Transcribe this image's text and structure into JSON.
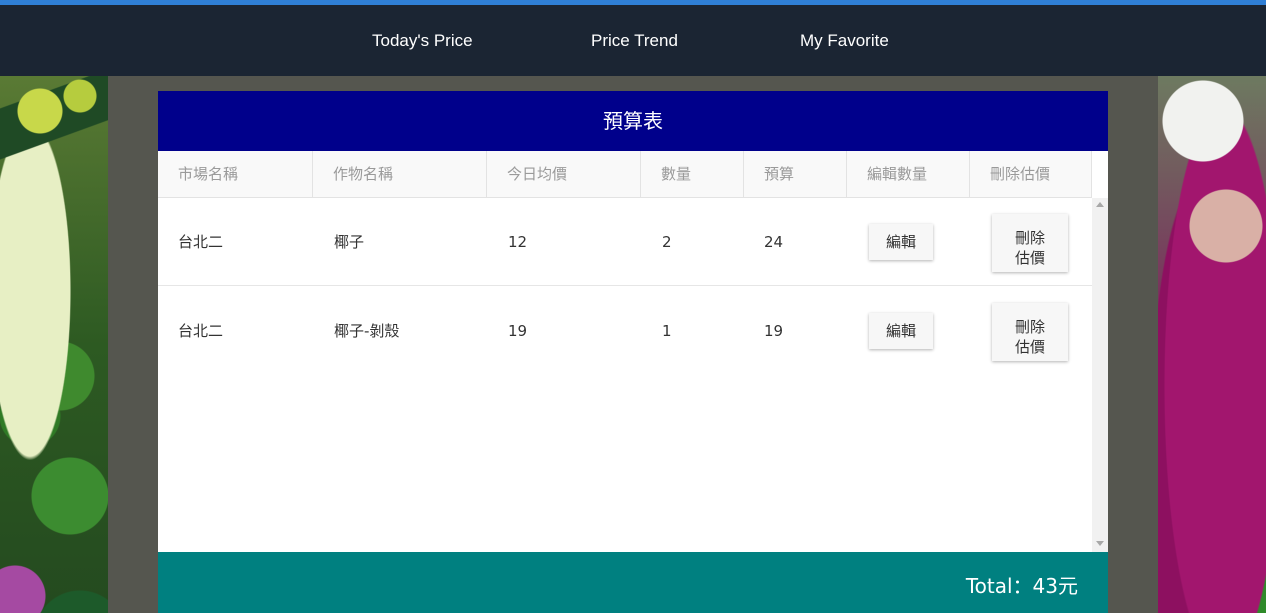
{
  "nav": {
    "items": [
      {
        "label": "Today's Price"
      },
      {
        "label": "Price Trend"
      },
      {
        "label": "My Favorite"
      }
    ]
  },
  "budget": {
    "title": "預算表",
    "columns": [
      "市場名稱",
      "作物名稱",
      "今日均價",
      "數量",
      "預算",
      "編輯數量",
      "刪除估價"
    ],
    "rows": [
      {
        "market": "台北二",
        "crop": "椰子",
        "avg_price": "12",
        "quantity": "2",
        "budget": "24",
        "edit_label": "編輯",
        "delete_label": "刪除\n估價"
      },
      {
        "market": "台北二",
        "crop": "椰子-剝殼",
        "avg_price": "19",
        "quantity": "1",
        "budget": "19",
        "edit_label": "編輯",
        "delete_label": "刪除\n估價"
      }
    ],
    "total": "Total：43元"
  },
  "colors": {
    "topbar": "#1b2533",
    "accent_line": "#2f7fd6",
    "header": "#00008b",
    "footer": "#008080"
  },
  "icons": {
    "scroll_up": "scroll-up-arrow-icon",
    "scroll_down": "scroll-down-arrow-icon"
  }
}
